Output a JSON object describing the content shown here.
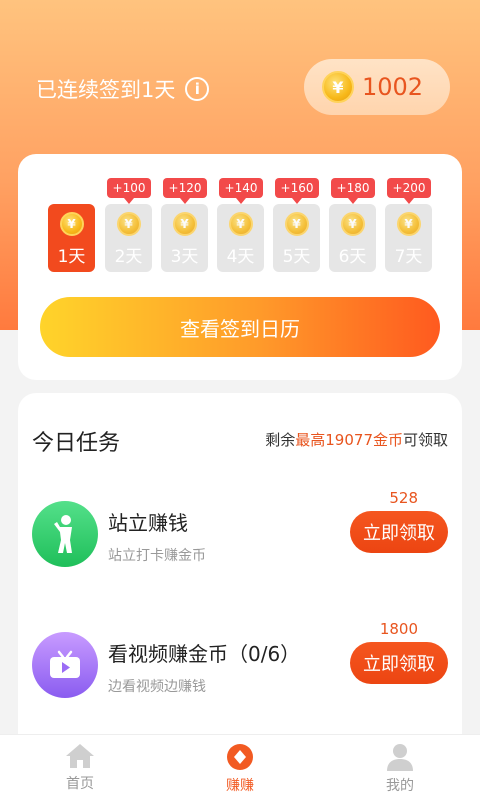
{
  "header": {
    "streak_text": "已连续签到1天",
    "info_icon": "i",
    "coin_symbol": "¥",
    "coin_balance": "1002"
  },
  "checkin": {
    "days": [
      {
        "label": "1天",
        "bonus": "",
        "active": true
      },
      {
        "label": "2天",
        "bonus": "+100",
        "active": false
      },
      {
        "label": "3天",
        "bonus": "+120",
        "active": false
      },
      {
        "label": "4天",
        "bonus": "+140",
        "active": false
      },
      {
        "label": "5天",
        "bonus": "+160",
        "active": false
      },
      {
        "label": "6天",
        "bonus": "+180",
        "active": false
      },
      {
        "label": "7天",
        "bonus": "+200",
        "active": false
      }
    ],
    "calendar_button": "查看签到日历"
  },
  "tasks": {
    "title": "今日任务",
    "remaining_prefix": "剩余",
    "remaining_highlight": "最高19077金币",
    "remaining_suffix": "可领取",
    "items": [
      {
        "title": "站立赚钱",
        "subtitle": "站立打卡赚金币",
        "reward": "528",
        "button": "立即领取",
        "icon": "standing-person-icon"
      },
      {
        "title": "看视频赚金币（0/6）",
        "subtitle": "边看视频边赚钱",
        "reward": "1800",
        "button": "立即领取",
        "icon": "tv-play-icon"
      }
    ]
  },
  "tabbar": {
    "tabs": [
      {
        "label": "首页",
        "icon": "home-icon",
        "active": false
      },
      {
        "label": "赚赚",
        "icon": "earn-icon",
        "active": true
      },
      {
        "label": "我的",
        "icon": "profile-icon",
        "active": false
      }
    ]
  },
  "colors": {
    "accent": "#f25a22",
    "header_gradient_top": "#ffc37e",
    "header_gradient_bottom": "#ff7a3e"
  }
}
